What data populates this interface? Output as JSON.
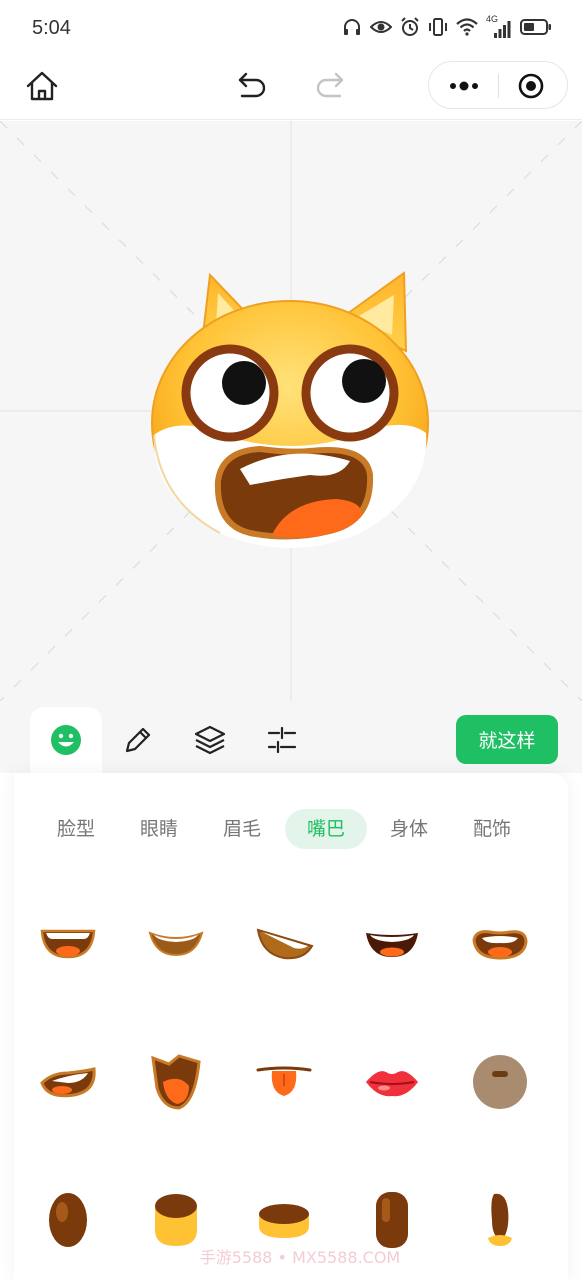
{
  "status_bar": {
    "time": "5:04",
    "icons": [
      "headphones-icon",
      "eye-icon",
      "alarm-icon",
      "vibrate-icon",
      "wifi-icon",
      "signal-icon",
      "battery-icon"
    ],
    "network_label": "4G"
  },
  "nav": {
    "home_icon": "home-icon",
    "undo_icon": "undo-icon",
    "redo_icon": "redo-icon",
    "capsule_icons": [
      "more-icon",
      "close-target-icon"
    ]
  },
  "toolbar": {
    "tools": [
      "emoji-icon",
      "pencil-icon",
      "layers-icon",
      "sliders-icon"
    ],
    "active_tool": "emoji-icon",
    "done_label": "就这样"
  },
  "categories": {
    "items": [
      {
        "label": "脸型"
      },
      {
        "label": "眼睛"
      },
      {
        "label": "眉毛"
      },
      {
        "label": "嘴巴"
      },
      {
        "label": "身体"
      },
      {
        "label": "配饰"
      }
    ],
    "active": "嘴巴"
  },
  "mouth_items": [
    "mouth-open-wide",
    "mouth-smile-teeth",
    "mouth-tilted-grin",
    "mouth-laugh",
    "mouth-open-tongue",
    "mouth-side-grin",
    "mouth-shout",
    "mouth-tongue-out",
    "mouth-red-lips",
    "mouth-round-button",
    "mouth-oval",
    "mouth-cup",
    "mouth-disc",
    "mouth-pill",
    "mouth-bean"
  ],
  "watermark": "手游5588 • MX5588.COM",
  "colors": {
    "accent": "#1fbf63",
    "accent_light": "#e3f5ea",
    "mouth_brown": "#7a3a0c",
    "tongue": "#ff6a1a"
  }
}
